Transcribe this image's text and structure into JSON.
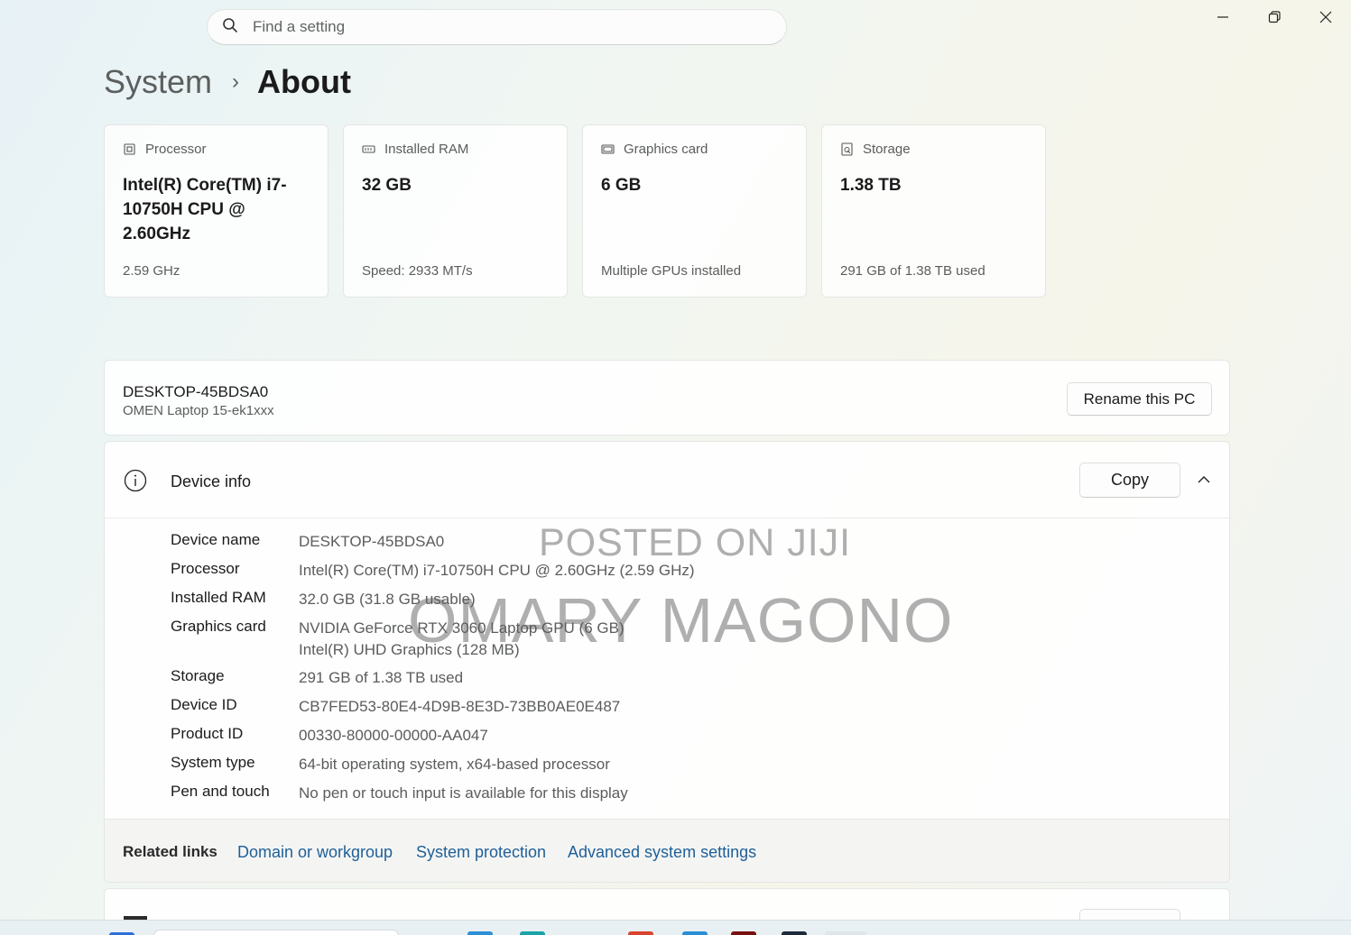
{
  "search": {
    "placeholder": "Find a setting"
  },
  "breadcrumb": {
    "parent": "System",
    "separator": "›",
    "current": "About"
  },
  "specs": [
    {
      "title": "Processor",
      "value": "Intel(R) Core(TM) i7-10750H CPU @ 2.60GHz",
      "sub": "2.59 GHz",
      "icon": "processor-icon"
    },
    {
      "title": "Installed RAM",
      "value": "32 GB",
      "sub": "Speed: 2933 MT/s",
      "icon": "ram-icon"
    },
    {
      "title": "Graphics card",
      "value": "6 GB",
      "sub": "Multiple GPUs installed",
      "icon": "graphics-card-icon"
    },
    {
      "title": "Storage",
      "value": "1.38 TB",
      "sub": "291 GB of 1.38 TB used",
      "icon": "storage-icon"
    }
  ],
  "pc": {
    "name": "DESKTOP-45BDSA0",
    "model": "OMEN Laptop 15-ek1xxx",
    "rename_label": "Rename this PC"
  },
  "device_info": {
    "title": "Device info",
    "copy_label": "Copy",
    "rows": [
      {
        "key": "Device name",
        "value": "DESKTOP-45BDSA0"
      },
      {
        "key": "Processor",
        "value": "Intel(R) Core(TM) i7-10750H CPU @ 2.60GHz (2.59 GHz)"
      },
      {
        "key": "Installed RAM",
        "value": "32.0 GB (31.8 GB usable)"
      },
      {
        "key": "Graphics card",
        "value": "NVIDIA GeForce RTX 3060 Laptop GPU (6 GB)",
        "value2": "Intel(R) UHD Graphics (128 MB)"
      },
      {
        "key": "Storage",
        "value": "291 GB of 1.38 TB used"
      },
      {
        "key": "Device ID",
        "value": "CB7FED53-80E4-4D9B-8E3D-73BB0AE0E487"
      },
      {
        "key": "Product ID",
        "value": "00330-80000-00000-AA047"
      },
      {
        "key": "System type",
        "value": "64-bit operating system, x64-based processor"
      },
      {
        "key": "Pen and touch",
        "value": "No pen or touch input is available for this display"
      }
    ]
  },
  "related_links": {
    "label": "Related links",
    "links": [
      "Domain or workgroup",
      "System protection",
      "Advanced system settings"
    ]
  },
  "watermark": {
    "line1": "POSTED ON JIJI",
    "line2": "OMARY MAGONO"
  },
  "colors": {
    "link": "#1f5f99",
    "start_button": "#2d6fd6"
  }
}
